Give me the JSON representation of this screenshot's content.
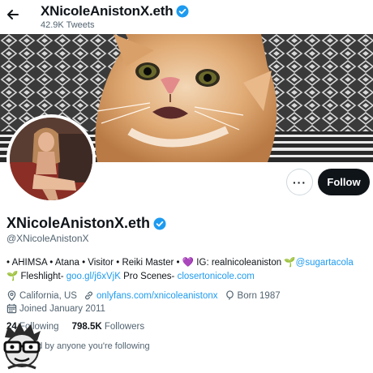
{
  "header": {
    "back_icon": "arrow-left-icon",
    "display_name": "XNicoleAnistonX.eth",
    "tweet_count": "42.9K Tweets"
  },
  "profile": {
    "display_name": "XNicoleAnistonX.eth",
    "handle": "@XNicoleAnistonX",
    "verified_color": "#1d9bf0",
    "more_label": "···",
    "follow_label": "Follow"
  },
  "bio": {
    "line1_text": "• AHIMSA • Atana • Visitor • Reiki Master • ",
    "line1_heart": "💜",
    "line1_ig": " IG: realnicoleaniston ",
    "line1_sprout": "🌱",
    "line1_link": "@sugartacola",
    "line2_sprout": "🌱",
    "line2_fleshlight": " Fleshlight- ",
    "line2_link1": "goo.gl/j6xVjK",
    "line2_scenes": " Pro Scenes- ",
    "line2_link2": "closertonicole.com"
  },
  "meta": {
    "location": "California, US",
    "website": "onlyfans.com/xnicoleanistonx",
    "born": "Born 1987",
    "joined": "Joined January 2011"
  },
  "stats": {
    "following_count": "24",
    "following_label": "Following",
    "followers_count": "798.5K",
    "followers_label": "Followers"
  },
  "followed_by": "ed by anyone you're following",
  "colors": {
    "link": "#1d9bf0",
    "button_dark": "#0f1419",
    "secondary_text": "#536471"
  }
}
